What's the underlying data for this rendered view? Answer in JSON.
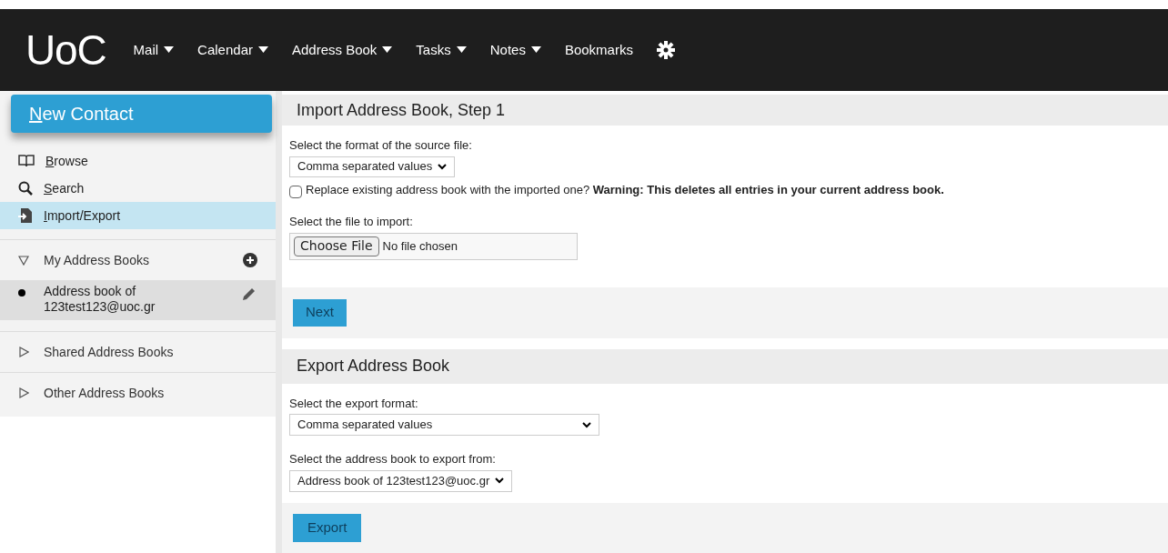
{
  "header": {
    "logo": "UoC",
    "menu": [
      {
        "label": "Mail",
        "has_menu": true
      },
      {
        "label": "Calendar",
        "has_menu": true
      },
      {
        "label": "Address Book",
        "has_menu": true
      },
      {
        "label": "Tasks",
        "has_menu": true
      },
      {
        "label": "Notes",
        "has_menu": true
      },
      {
        "label": "Bookmarks",
        "has_menu": false
      }
    ]
  },
  "sidebar": {
    "new_contact": "New Contact",
    "nav": [
      {
        "kind": "browse",
        "label": "Browse",
        "selected": false
      },
      {
        "kind": "search",
        "label": "Search",
        "selected": false
      },
      {
        "kind": "import",
        "label": "Import/Export",
        "selected": true
      }
    ],
    "groups": [
      {
        "label": "My Address Books",
        "expanded": true,
        "can_add": true,
        "children": [
          {
            "label": "Address book of 123test123@uoc.gr",
            "selected": true
          }
        ]
      },
      {
        "label": "Shared Address Books",
        "expanded": false,
        "can_add": false
      },
      {
        "label": "Other Address Books",
        "expanded": false,
        "can_add": false
      }
    ]
  },
  "import": {
    "title": "Import Address Book, Step 1",
    "format_label": "Select the format of the source file:",
    "format_value": "Comma separated values",
    "replace_checked": false,
    "replace_text": "Replace existing address book with the imported one? **Warning: This deletes all entries in your current address book.**",
    "file_label": "Select the file to import:",
    "file_button": "Choose File",
    "file_status": "No file chosen",
    "next": "Next"
  },
  "export": {
    "title": "Export Address Book",
    "format_label": "Select the export format:",
    "format_value": "Comma separated values",
    "book_label": "Select the address book to export from:",
    "book_value": "Address book of 123test123@uoc.gr",
    "button": "Export"
  }
}
